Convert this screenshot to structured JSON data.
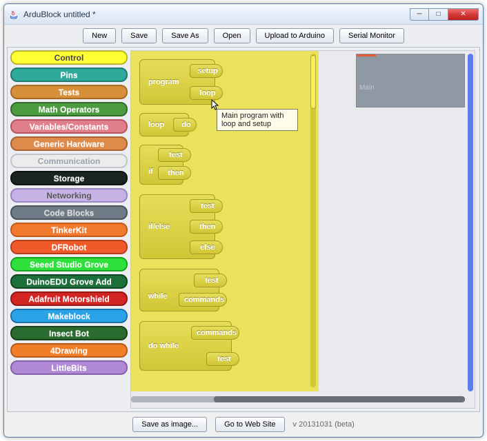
{
  "window": {
    "title": "ArduBlock untitled *"
  },
  "toolbar": {
    "new": "New",
    "save": "Save",
    "saveAs": "Save As",
    "open": "Open",
    "upload": "Upload to Arduino",
    "serial": "Serial Monitor"
  },
  "drawers": [
    {
      "label": "Control",
      "bg": "#ffff33",
      "fg": "#444",
      "bd": "#bdb530"
    },
    {
      "label": "Pins",
      "bg": "#2fa99a",
      "fg": "#fff",
      "bd": "#1f7a70"
    },
    {
      "label": "Tests",
      "bg": "#d78f3a",
      "fg": "#fff",
      "bd": "#a66a26"
    },
    {
      "label": "Math Operators",
      "bg": "#4c9b41",
      "fg": "#fff",
      "bd": "#336b2c"
    },
    {
      "label": "Variables/Constants",
      "bg": "#e07e8a",
      "fg": "#fff",
      "bd": "#b85562"
    },
    {
      "label": "Generic Hardware",
      "bg": "#dd8a4a",
      "fg": "#fff",
      "bd": "#a86334"
    },
    {
      "label": "Communication",
      "bg": "#ececec",
      "fg": "#9aa2ad",
      "bd": "#bfc4cc"
    },
    {
      "label": "Storage",
      "bg": "#1a251f",
      "fg": "#fff",
      "bd": "#0c120f"
    },
    {
      "label": "Networking",
      "bg": "#c7b2e6",
      "fg": "#555",
      "bd": "#9a86c0"
    },
    {
      "label": "Code Blocks",
      "bg": "#6e7a85",
      "fg": "#ddd",
      "bd": "#4a545d"
    },
    {
      "label": "TinkerKit",
      "bg": "#f27a2e",
      "fg": "#fff",
      "bd": "#c05a1a"
    },
    {
      "label": "DFRobot",
      "bg": "#f05a2a",
      "fg": "#fff",
      "bd": "#b83e18"
    },
    {
      "label": "Seeed Studio Grove",
      "bg": "#2de03a",
      "fg": "#fff",
      "bd": "#1aa225"
    },
    {
      "label": "DuinoEDU Grove Add",
      "bg": "#1d6f39",
      "fg": "#fff",
      "bd": "#0f4420"
    },
    {
      "label": "Adafruit Motorshield",
      "bg": "#d32424",
      "fg": "#fff",
      "bd": "#961616"
    },
    {
      "label": "Makeblock",
      "bg": "#2aa2e8",
      "fg": "#fff",
      "bd": "#1a72aa"
    },
    {
      "label": "Insect Bot",
      "bg": "#2a6b2f",
      "fg": "#fff",
      "bd": "#18421c"
    },
    {
      "label": "4Drawing",
      "bg": "#f07d28",
      "fg": "#fff",
      "bd": "#b85a18"
    },
    {
      "label": "LittleBits",
      "bg": "#b088d6",
      "fg": "#fff",
      "bd": "#8460a8"
    }
  ],
  "blocks": {
    "program": {
      "name": "program",
      "s1": "setup",
      "s2": "loop"
    },
    "loop": {
      "name": "loop",
      "s1": "do"
    },
    "if": {
      "name": "if",
      "s1": "test",
      "s2": "then"
    },
    "ifelse": {
      "name": "if/else",
      "s1": "test",
      "s2": "then",
      "s3": "else"
    },
    "while": {
      "name": "while",
      "s1": "test",
      "s2": "commands"
    },
    "dowhile": {
      "name": "do while",
      "s1": "commands",
      "s2": "test"
    }
  },
  "tooltip": "Main program with loop and setup",
  "minimap": {
    "label": "Main"
  },
  "footer": {
    "saveImage": "Save as image...",
    "gotoWeb": "Go to Web Site",
    "version": "v 20131031 (beta)"
  }
}
